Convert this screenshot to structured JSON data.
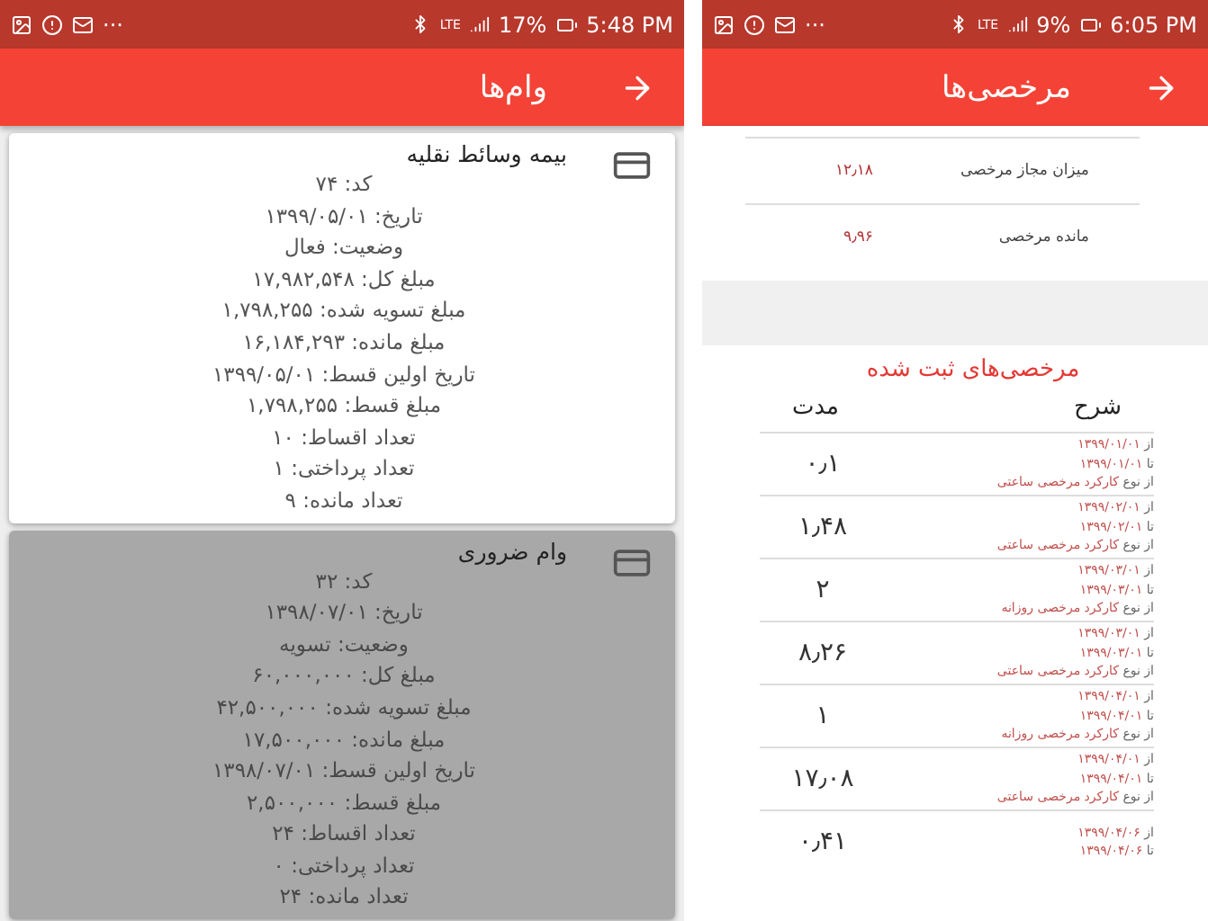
{
  "left_screen": {
    "status_bar": {
      "more": "···",
      "network": "LTE",
      "battery": "17%",
      "time": "5:48 PM"
    },
    "app_bar": {
      "title": "وام‌ها"
    },
    "loans": [
      {
        "title": "بیمه وسائط نقلیه",
        "disabled": false,
        "lines": [
          "کد: ۷۴",
          "تاریخ: ۱۳۹۹/۰۵/۰۱",
          "وضعیت: فعال",
          "مبلغ کل: ۱۷,۹۸۲,۵۴۸",
          "مبلغ تسویه شده: ۱,۷۹۸,۲۵۵",
          "مبلغ مانده: ۱۶,۱۸۴,۲۹۳",
          "تاریخ اولین قسط: ۱۳۹۹/۰۵/۰۱",
          "مبلغ قسط: ۱,۷۹۸,۲۵۵",
          "تعداد اقساط: ۱۰",
          "تعداد پرداختی: ۱",
          "تعداد مانده: ۹"
        ]
      },
      {
        "title": "وام ضروری",
        "disabled": true,
        "lines": [
          "کد: ۳۲",
          "تاریخ: ۱۳۹۸/۰۷/۰۱",
          "وضعیت: تسویه",
          "مبلغ کل: ۶۰,۰۰۰,۰۰۰",
          "مبلغ تسویه شده: ۴۲,۵۰۰,۰۰۰",
          "مبلغ مانده: ۱۷,۵۰۰,۰۰۰",
          "تاریخ اولین قسط: ۱۳۹۸/۰۷/۰۱",
          "مبلغ قسط: ۲,۵۰۰,۰۰۰",
          "تعداد اقساط: ۲۴",
          "تعداد پرداختی: ۰",
          "تعداد مانده: ۲۴"
        ]
      }
    ]
  },
  "right_screen": {
    "status_bar": {
      "more": "···",
      "network": "LTE",
      "battery": "9%",
      "time": "6:05 PM"
    },
    "app_bar": {
      "title": "مرخصی‌ها"
    },
    "summary": [
      {
        "label": "میزان مجاز مرخصی",
        "value": "۱۲٫۱۸"
      },
      {
        "label": "مانده مرخصی",
        "value": "۹٫۹۶"
      }
    ],
    "registered": {
      "title": "مرخصی‌های ثبت شده",
      "columns": [
        "شرح",
        "مدت"
      ],
      "rows": [
        {
          "from_label": "از",
          "from": "۱۳۹۹/۰۱/۰۱",
          "to_label": "تا",
          "to": "۱۳۹۹/۰۱/۰۱",
          "type_label": "از نوع",
          "type": "کارکرد مرخصی ساعتی",
          "duration": "۰٫۱"
        },
        {
          "from_label": "از",
          "from": "۱۳۹۹/۰۲/۰۱",
          "to_label": "تا",
          "to": "۱۳۹۹/۰۲/۰۱",
          "type_label": "از نوع",
          "type": "کارکرد مرخصی ساعتی",
          "duration": "۱٫۴۸"
        },
        {
          "from_label": "از",
          "from": "۱۳۹۹/۰۳/۰۱",
          "to_label": "تا",
          "to": "۱۳۹۹/۰۳/۰۱",
          "type_label": "از نوع",
          "type": "کارکرد مرخصی روزانه",
          "duration": "۲"
        },
        {
          "from_label": "از",
          "from": "۱۳۹۹/۰۳/۰۱",
          "to_label": "تا",
          "to": "۱۳۹۹/۰۳/۰۱",
          "type_label": "از نوع",
          "type": "کارکرد مرخصی ساعتی",
          "duration": "۸٫۲۶"
        },
        {
          "from_label": "از",
          "from": "۱۳۹۹/۰۴/۰۱",
          "to_label": "تا",
          "to": "۱۳۹۹/۰۴/۰۱",
          "type_label": "از نوع",
          "type": "کارکرد مرخصی روزانه",
          "duration": "۱"
        },
        {
          "from_label": "از",
          "from": "۱۳۹۹/۰۴/۰۱",
          "to_label": "تا",
          "to": "۱۳۹۹/۰۴/۰۱",
          "type_label": "از نوع",
          "type": "کارکرد مرخصی ساعتی",
          "duration": "۱۷٫۰۸"
        },
        {
          "from_label": "از",
          "from": "۱۳۹۹/۰۴/۰۶",
          "to_label": "تا",
          "to": "۱۳۹۹/۰۴/۰۶",
          "duration": "۰٫۴۱"
        }
      ]
    }
  }
}
